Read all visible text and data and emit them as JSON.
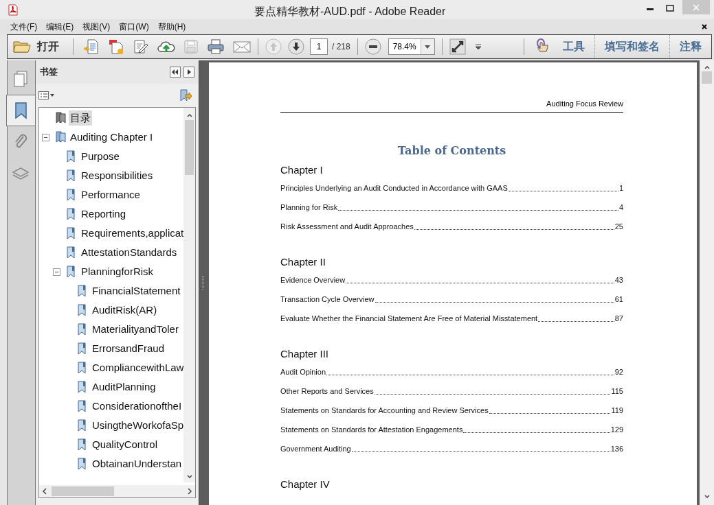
{
  "window": {
    "title": "要点精华教材-AUD.pdf - Adobe Reader"
  },
  "menu": [
    "文件(F)",
    "编辑(E)",
    "视图(V)",
    "窗口(W)",
    "帮助(H)"
  ],
  "toolbar": {
    "open_label": "打开",
    "page_value": "1",
    "page_total": "/ 218",
    "zoom_value": "78.4%",
    "panels": [
      "工具",
      "填写和签名",
      "注释"
    ]
  },
  "side_tabs": [
    {
      "kind": "pages",
      "selected": false
    },
    {
      "kind": "bookmarks",
      "selected": true
    },
    {
      "kind": "attachments",
      "selected": false
    },
    {
      "kind": "layers",
      "selected": false
    }
  ],
  "bookmarks_panel": {
    "title": "书签",
    "tree": [
      {
        "label": "目录",
        "kind": "toc",
        "selected": true
      },
      {
        "label": "Auditing Chapter I",
        "kind": "chapter",
        "selected": false,
        "expanded": true,
        "children": [
          {
            "label": "Purpose",
            "kind": "section",
            "selected": false
          },
          {
            "label": "Responsibilities",
            "kind": "section",
            "selected": false
          },
          {
            "label": "Performance",
            "kind": "section",
            "selected": false
          },
          {
            "label": "Reporting",
            "kind": "section",
            "selected": false
          },
          {
            "label": "Requirements,applicat",
            "kind": "section",
            "selected": false
          },
          {
            "label": "AttestationStandards",
            "kind": "section",
            "selected": false
          },
          {
            "label": "PlanningforRisk",
            "kind": "section",
            "selected": false,
            "expanded": true,
            "children": [
              {
                "label": "FinancialStatement",
                "kind": "section",
                "selected": false
              },
              {
                "label": "AuditRisk(AR)",
                "kind": "section",
                "selected": false
              },
              {
                "label": "MaterialityandToler",
                "kind": "section",
                "selected": false
              },
              {
                "label": "ErrorsandFraud",
                "kind": "section",
                "selected": false
              },
              {
                "label": "CompliancewithLaw",
                "kind": "section",
                "selected": false
              },
              {
                "label": "AuditPlanning",
                "kind": "section",
                "selected": false
              },
              {
                "label": "ConsiderationoftheI",
                "kind": "section",
                "selected": false
              },
              {
                "label": "UsingtheWorkofaSp",
                "kind": "section",
                "selected": false
              },
              {
                "label": "QualityControl",
                "kind": "section",
                "selected": false
              },
              {
                "label": "ObtainanUnderstan",
                "kind": "section",
                "selected": false
              }
            ]
          }
        ]
      }
    ]
  },
  "document": {
    "running_header": "Auditing Focus Review",
    "title": "Table of Contents",
    "sections": [
      {
        "heading": "Chapter I",
        "entries": [
          {
            "title": "Principles Underlying an Audit Conducted in Accordance with GAAS",
            "page": "1"
          },
          {
            "title": "Planning for Risk",
            "page": "4"
          },
          {
            "title": "Risk Assessment and Audit Approaches",
            "page": "25"
          }
        ]
      },
      {
        "heading": "Chapter II",
        "entries": [
          {
            "title": "Evidence Overview",
            "page": "43"
          },
          {
            "title": "Transaction Cycle Overview",
            "page": "61"
          },
          {
            "title": "Evaluate Whether the Financial Statement Are Free of Material Misstatement",
            "page": "87"
          }
        ]
      },
      {
        "heading": "Chapter III",
        "entries": [
          {
            "title": "Audit Opinion",
            "page": "92"
          },
          {
            "title": "Other Reports and Services",
            "page": "115"
          },
          {
            "title": "Statements on Standards for Accounting and Review Services",
            "page": "119"
          },
          {
            "title": "Statements on Standards for Attestation Engagements",
            "page": "129"
          },
          {
            "title": "Government Auditing",
            "page": "136"
          }
        ]
      },
      {
        "heading": "Chapter IV"
      }
    ]
  }
}
